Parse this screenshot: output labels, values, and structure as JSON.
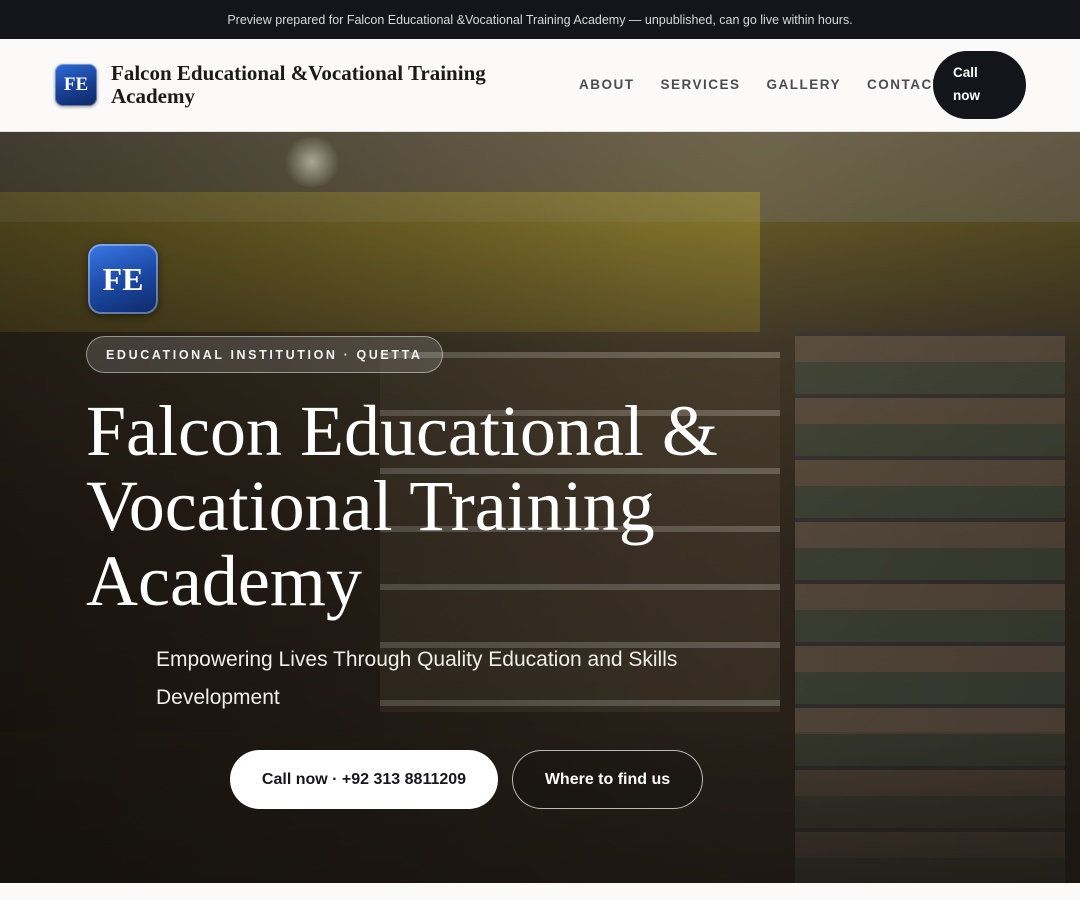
{
  "preview_bar": {
    "text": "Preview prepared for Falcon Educational &Vocational Training Academy — unpublished, can go live within hours."
  },
  "header": {
    "logo_initials": "FE",
    "brand_name": "Falcon Educational &Vocational Training Academy",
    "nav": [
      "ABOUT",
      "SERVICES",
      "GALLERY",
      "CONTACT"
    ],
    "call_button": "Call now"
  },
  "hero": {
    "logo_initials": "FE",
    "eyebrow": "EDUCATIONAL INSTITUTION · QUETTA",
    "title": "Falcon Educational & Vocational Training Academy",
    "subtitle": "Empowering Lives Through Quality Education and Skills Development",
    "primary_button": "Call now · +92 313 8811209",
    "secondary_button": "Where to find us"
  },
  "colors": {
    "dark": "#14151b",
    "logo_blue": "#1c4aa6",
    "header_bg": "#fbfaf8"
  }
}
